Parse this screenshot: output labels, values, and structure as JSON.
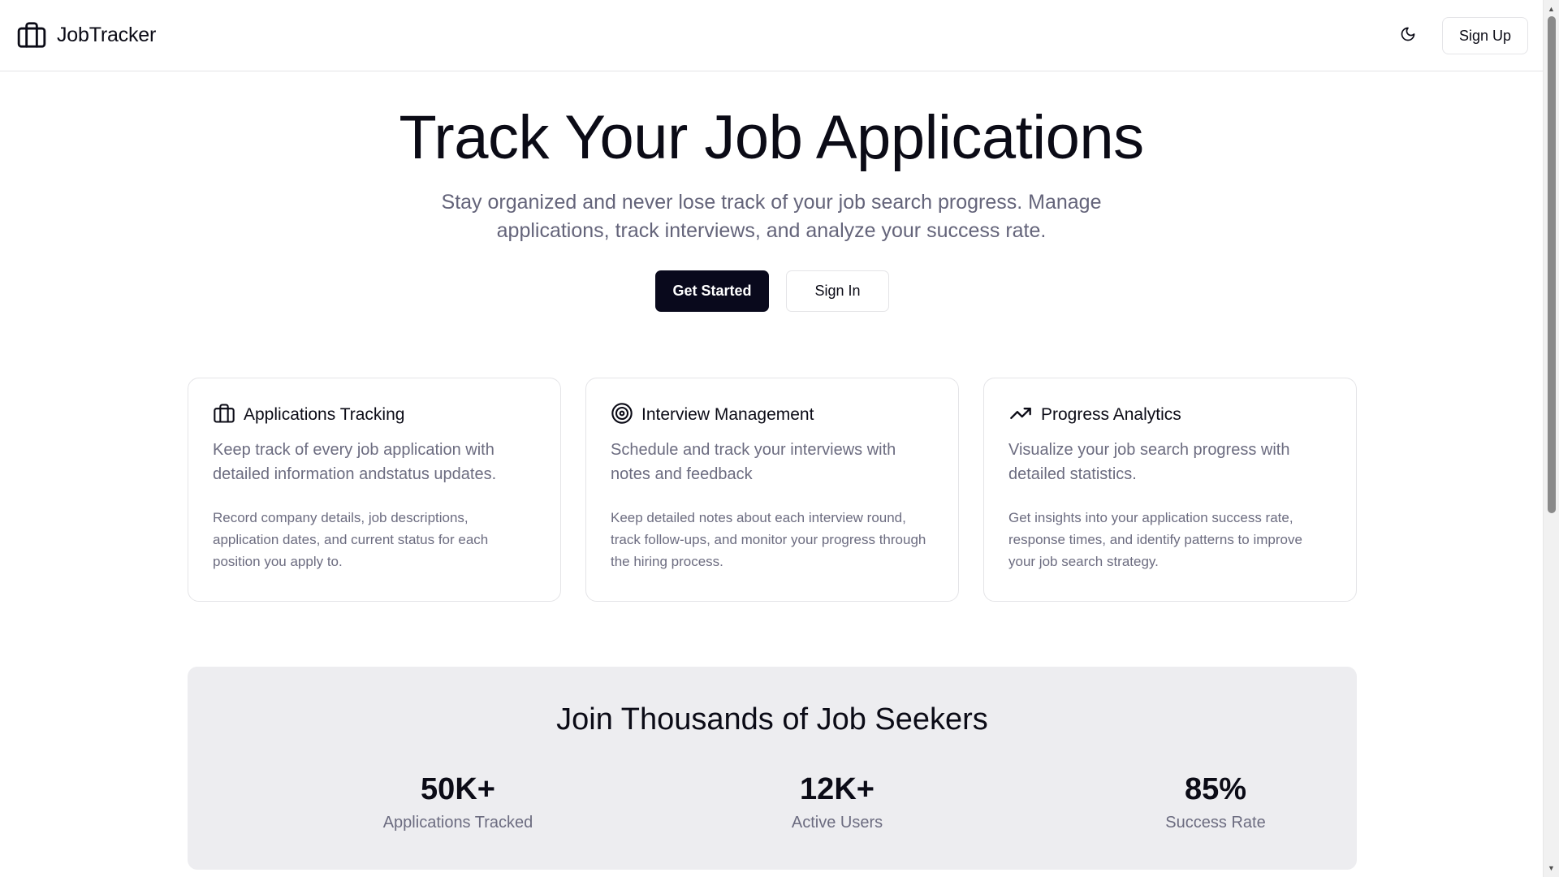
{
  "header": {
    "brand": "JobTracker",
    "brand_icon": "briefcase-icon",
    "theme_icon": "moon-icon",
    "signup_label": "Sign Up"
  },
  "hero": {
    "title": "Track Your Job Applications",
    "subtitle": "Stay organized and never lose track of your job search progress. Manage applications, track interviews, and analyze your success rate.",
    "primary_label": "Get Started",
    "secondary_label": "Sign In"
  },
  "features": [
    {
      "icon": "briefcase-icon",
      "title": "Applications Tracking",
      "description": "Keep track of every job application with detailed information andstatus updates.",
      "body": "Record company details, job descriptions, application dates, and current status for each position you apply to."
    },
    {
      "icon": "target-icon",
      "title": "Interview Management",
      "description": "Schedule and track your interviews with notes and feedback",
      "body": "Keep detailed notes about each interview round, track follow-ups, and monitor your progress through the hiring process."
    },
    {
      "icon": "trending-up-icon",
      "title": "Progress Analytics",
      "description": "Visualize your job search progress with detailed statistics.",
      "body": "Get insights into your application success rate, response times, and identify patterns to improve your job search strategy."
    }
  ],
  "stats": {
    "title": "Join Thousands of Job Seekers",
    "items": [
      {
        "value": "50K+",
        "label": "Applications Tracked"
      },
      {
        "value": "12K+",
        "label": "Active Users"
      },
      {
        "value": "85%",
        "label": "Success Rate"
      }
    ]
  },
  "colors": {
    "primary": "#09091c",
    "muted_text": "#6c6c80",
    "border": "#e4e4e7",
    "panel_bg": "#ededf0"
  }
}
